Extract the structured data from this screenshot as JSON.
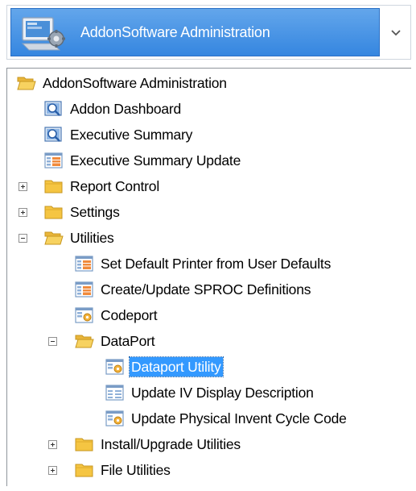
{
  "module_selector": {
    "label": "AddonSoftware Administration",
    "icon": "admin-computer-icon",
    "dropdown_icon": "chevron-down-icon"
  },
  "tree": {
    "nodes": [
      {
        "label": "AddonSoftware Administration",
        "icon": "folder-open-icon",
        "level": 0,
        "expander": "none"
      },
      {
        "label": "Addon Dashboard",
        "icon": "dashboard-icon",
        "level": 1,
        "expander": "none"
      },
      {
        "label": "Executive Summary",
        "icon": "dashboard-icon",
        "level": 1,
        "expander": "none"
      },
      {
        "label": "Executive Summary Update",
        "icon": "form-icon",
        "level": 1,
        "expander": "none"
      },
      {
        "label": "Report Control",
        "icon": "folder-icon",
        "level": 1,
        "expander": "plus"
      },
      {
        "label": "Settings",
        "icon": "folder-icon",
        "level": 1,
        "expander": "plus"
      },
      {
        "label": "Utilities",
        "icon": "folder-open-icon",
        "level": 1,
        "expander": "minus"
      },
      {
        "label": "Set Default Printer from User Defaults",
        "icon": "form-icon",
        "level": 2,
        "expander": "none"
      },
      {
        "label": "Create/Update SPROC Definitions",
        "icon": "form-icon",
        "level": 2,
        "expander": "none"
      },
      {
        "label": "Codeport",
        "icon": "process-icon",
        "level": 2,
        "expander": "none"
      },
      {
        "label": "DataPort",
        "icon": "folder-open-icon",
        "level": 2,
        "expander": "minus"
      },
      {
        "label": "Dataport Utility",
        "icon": "process-icon",
        "level": 3,
        "expander": "none",
        "selected": true
      },
      {
        "label": "Update IV Display Description",
        "icon": "grid-form-icon",
        "level": 3,
        "expander": "none"
      },
      {
        "label": "Update Physical Invent Cycle Code",
        "icon": "process-icon",
        "level": 3,
        "expander": "none"
      },
      {
        "label": "Install/Upgrade Utilities",
        "icon": "folder-icon",
        "level": 2,
        "expander": "plus"
      },
      {
        "label": "File Utilities",
        "icon": "folder-icon",
        "level": 2,
        "expander": "plus"
      }
    ]
  },
  "colors": {
    "selection": "#3399ff",
    "header_gradient_top": "#63a6eb",
    "header_gradient_bottom": "#3586e0",
    "folder": "#f5c542",
    "panel_border": "#8f959c"
  }
}
